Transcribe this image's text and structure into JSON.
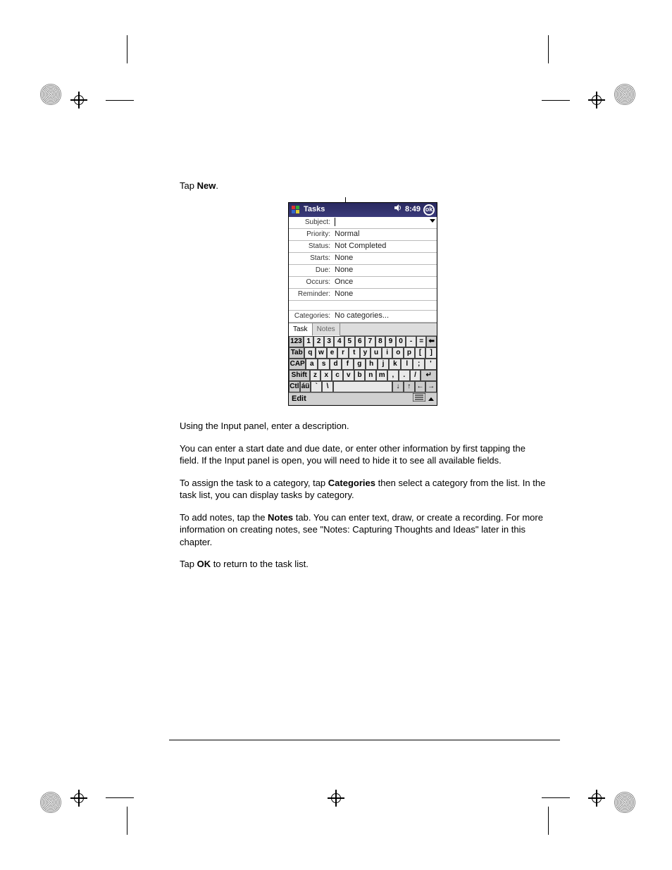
{
  "instructions": {
    "tap_new_pre": "Tap ",
    "tap_new_bold": "New",
    "tap_new_post": ".",
    "p1": "Using the Input panel, enter a description.",
    "p2": "You can enter a start date and due date, or enter other information by first tapping the field. If the Input panel is open, you will need to hide it to see all available fields.",
    "p3_pre": "To assign the task to a category, tap ",
    "p3_bold": "Categories",
    "p3_post": " then select a category from the list. In the task list, you can display tasks by category.",
    "p4_pre": "To add notes, tap the ",
    "p4_bold": "Notes",
    "p4_post": " tab. You can enter text, draw, or create a recording. For more information on creating notes, see \"Notes: Capturing Thoughts and Ideas\" later in this chapter.",
    "p5_pre": "Tap ",
    "p5_bold": "OK",
    "p5_post": " to return to the task list."
  },
  "device": {
    "title": "Tasks",
    "time": "8:49",
    "ok": "ok",
    "fields": {
      "subject_label": "Subject:",
      "subject_value": "",
      "priority_label": "Priority:",
      "priority_value": "Normal",
      "status_label": "Status:",
      "status_value": "Not Completed",
      "starts_label": "Starts:",
      "starts_value": "None",
      "due_label": "Due:",
      "due_value": "None",
      "occurs_label": "Occurs:",
      "occurs_value": "Once",
      "reminder_label": "Reminder:",
      "reminder_value": "None",
      "categories_label": "Categories:",
      "categories_value": "No categories..."
    },
    "tabs": {
      "task": "Task",
      "notes": "Notes"
    },
    "keyboard": {
      "r1": [
        "123",
        "1",
        "2",
        "3",
        "4",
        "5",
        "6",
        "7",
        "8",
        "9",
        "0",
        "-",
        "=",
        "⬅"
      ],
      "r2": [
        "Tab",
        "q",
        "w",
        "e",
        "r",
        "t",
        "y",
        "u",
        "i",
        "o",
        "p",
        "[",
        "]"
      ],
      "r3": [
        "CAP",
        "a",
        "s",
        "d",
        "f",
        "g",
        "h",
        "j",
        "k",
        "l",
        ";",
        "'"
      ],
      "r4": [
        "Shift",
        "z",
        "x",
        "c",
        "v",
        "b",
        "n",
        "m",
        ",",
        ".",
        "/",
        "↵"
      ],
      "r5": [
        "Ctl",
        "áü",
        "`",
        "\\",
        " ",
        "↓",
        "↑",
        "←",
        "→"
      ]
    },
    "bottom": {
      "edit": "Edit"
    }
  }
}
